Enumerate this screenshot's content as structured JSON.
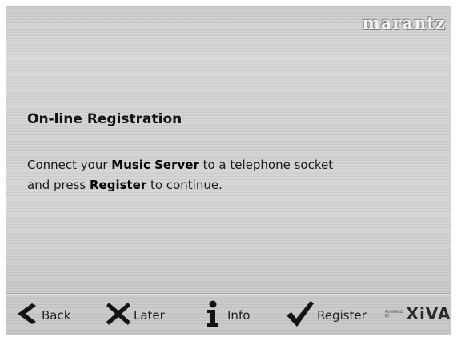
{
  "brand": {
    "name": "marantz"
  },
  "content": {
    "title": "On-line Registration",
    "line1_prefix": "Connect your ",
    "line1_bold": "Music Server",
    "line1_suffix": " to a telephone socket",
    "line2_prefix": "and press ",
    "line2_bold": "Register",
    "line2_suffix": " to continue."
  },
  "footer": {
    "buttons": [
      {
        "label": "Back",
        "icon": "left-arrow-icon"
      },
      {
        "label": "Later",
        "icon": "x-icon"
      },
      {
        "label": "Info",
        "icon": "info-icon"
      },
      {
        "label": "Register",
        "icon": "checkmark-icon"
      }
    ],
    "powered_by": "POWERED BY",
    "partner_logo": "XiVA"
  },
  "colors": {
    "icon": "#141414",
    "panel": "#cfcfcf",
    "text": "#111111"
  }
}
